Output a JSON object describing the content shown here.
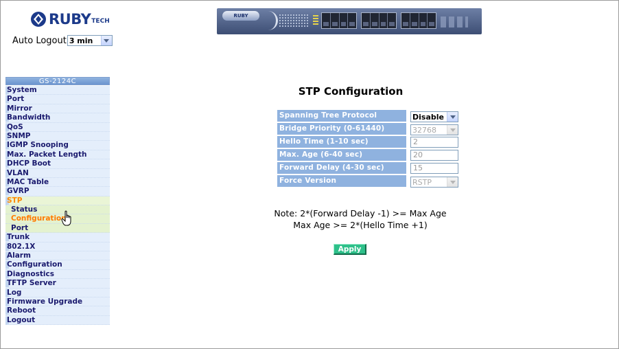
{
  "colors": {
    "menu_active": "#ff8800",
    "menu_text": "#1a1a6e",
    "label_bg": "#8fb2df",
    "apply_bg": "#2ec08a"
  },
  "logo": {
    "brand": "RUBY",
    "suffix": "TECH"
  },
  "auto_logout": {
    "label": "Auto Logout",
    "value": "3 min"
  },
  "device": {
    "brand": "RUBY"
  },
  "sidebar": {
    "title": "GS-2124C",
    "items": [
      {
        "label": "System"
      },
      {
        "label": "Port"
      },
      {
        "label": "Mirror"
      },
      {
        "label": "Bandwidth"
      },
      {
        "label": "QoS"
      },
      {
        "label": "SNMP"
      },
      {
        "label": "IGMP Snooping"
      },
      {
        "label": "Max. Packet Length"
      },
      {
        "label": "DHCP Boot"
      },
      {
        "label": "VLAN"
      },
      {
        "label": "MAC Table"
      },
      {
        "label": "GVRP"
      },
      {
        "label": "STP"
      },
      {
        "label": "Status"
      },
      {
        "label": "Configuration"
      },
      {
        "label": "Port"
      },
      {
        "label": "Trunk"
      },
      {
        "label": "802.1X"
      },
      {
        "label": "Alarm"
      },
      {
        "label": "Configuration"
      },
      {
        "label": "Diagnostics"
      },
      {
        "label": "TFTP Server"
      },
      {
        "label": "Log"
      },
      {
        "label": "Firmware Upgrade"
      },
      {
        "label": "Reboot"
      },
      {
        "label": "Logout"
      }
    ]
  },
  "main": {
    "title": "STP Configuration",
    "fields": [
      {
        "label": "Spanning Tree Protocol",
        "value": "Disable"
      },
      {
        "label": "Bridge Priority (0-61440)",
        "value": "32768"
      },
      {
        "label": "Hello Time (1-10 sec)",
        "value": "2"
      },
      {
        "label": "Max. Age (6-40 sec)",
        "value": "20"
      },
      {
        "label": "Forward Delay (4-30 sec)",
        "value": "15"
      },
      {
        "label": "Force Version",
        "value": "RSTP"
      }
    ],
    "note_line1": "Note: 2*(Forward Delay -1) >= Max Age",
    "note_line2": "Max Age >= 2*(Hello Time +1)",
    "apply_label": "Apply"
  }
}
